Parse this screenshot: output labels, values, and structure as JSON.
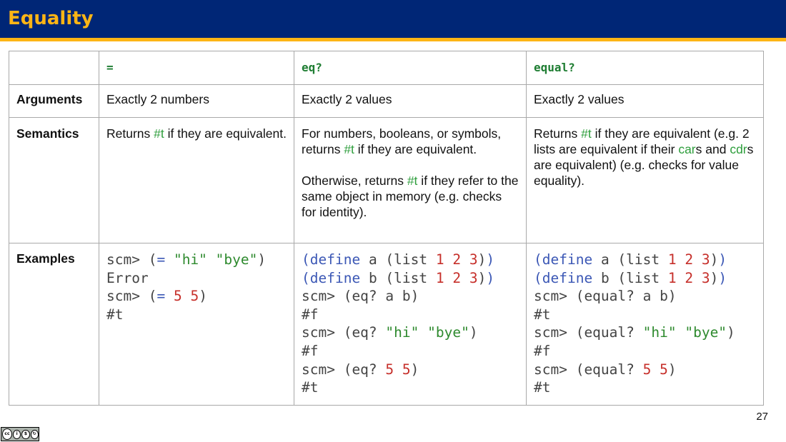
{
  "title": "Equality",
  "page_number": "27",
  "license_badge": {
    "icons": [
      "cc-icon",
      "by-icon",
      "nc-icon",
      "sa-icon"
    ],
    "glyphs": [
      "cc",
      "i",
      "$",
      "↻"
    ],
    "labels": [
      "BY",
      "NC",
      "SA"
    ]
  },
  "colors": {
    "header_bg": "#002676",
    "accent": "#FDB515",
    "code_keyword": "#3b57b5",
    "code_string": "#2e8a2e",
    "code_number": "#c62f2a",
    "highlight_green": "#2e9e3c"
  },
  "table": {
    "headers": [
      "",
      "=",
      "eq?",
      "equal?"
    ],
    "arguments": {
      "label": "Arguments",
      "values": [
        "Exactly 2 numbers",
        "Exactly 2 values",
        "Exactly 2 values"
      ]
    },
    "semantics": {
      "label": "Semantics",
      "col1": {
        "a": "Returns ",
        "t": "#t",
        "b": " if they are equivalent."
      },
      "col2": {
        "p1a": "For numbers, booleans, or symbols, returns ",
        "p1t": "#t",
        "p1b": " if they are equivalent.",
        "p2a": "Otherwise, returns ",
        "p2t": "#t",
        "p2b": " if they refer to the same object in memory (e.g. checks for identity)."
      },
      "col3": {
        "a": "Returns ",
        "t": "#t",
        "b": " if they are equivalent (e.g. 2 lists are equivalent if their ",
        "car": "car",
        "c": "s and ",
        "cdr": "cdr",
        "d": "s are equivalent) (e.g. checks for value equality)."
      }
    },
    "examples": {
      "label": "Examples",
      "col1": [
        [
          [
            "t-plain",
            "scm> ("
          ],
          [
            "t-op",
            "="
          ],
          [
            "t-plain",
            " "
          ],
          [
            "t-str",
            "\"hi\""
          ],
          [
            "t-plain",
            " "
          ],
          [
            "t-str",
            "\"bye\""
          ],
          [
            "t-plain",
            ")"
          ]
        ],
        [
          [
            "t-plain",
            "Error"
          ]
        ],
        [
          [
            "t-plain",
            "scm> ("
          ],
          [
            "t-op",
            "="
          ],
          [
            "t-plain",
            " "
          ],
          [
            "t-num",
            "5"
          ],
          [
            "t-plain",
            " "
          ],
          [
            "t-num",
            "5"
          ],
          [
            "t-plain",
            ")"
          ]
        ],
        [
          [
            "t-plain",
            "#t"
          ]
        ]
      ],
      "col2": [
        [
          [
            "t-kw",
            "("
          ],
          [
            "t-kw",
            "define"
          ],
          [
            "t-plain",
            " a (list "
          ],
          [
            "t-num",
            "1"
          ],
          [
            "t-plain",
            " "
          ],
          [
            "t-num",
            "2"
          ],
          [
            "t-plain",
            " "
          ],
          [
            "t-num",
            "3"
          ],
          [
            "t-plain",
            ")"
          ],
          [
            "t-kw",
            ")"
          ]
        ],
        [
          [
            "t-kw",
            "("
          ],
          [
            "t-kw",
            "define"
          ],
          [
            "t-plain",
            " b (list "
          ],
          [
            "t-num",
            "1"
          ],
          [
            "t-plain",
            " "
          ],
          [
            "t-num",
            "2"
          ],
          [
            "t-plain",
            " "
          ],
          [
            "t-num",
            "3"
          ],
          [
            "t-plain",
            ")"
          ],
          [
            "t-kw",
            ")"
          ]
        ],
        [
          [
            "t-plain",
            "scm> (eq? a b)"
          ]
        ],
        [
          [
            "t-plain",
            "#f"
          ]
        ],
        [
          [
            "t-plain",
            "scm> (eq? "
          ],
          [
            "t-str",
            "\"hi\""
          ],
          [
            "t-plain",
            " "
          ],
          [
            "t-str",
            "\"bye\""
          ],
          [
            "t-plain",
            ")"
          ]
        ],
        [
          [
            "t-plain",
            "#f"
          ]
        ],
        [
          [
            "t-plain",
            "scm> (eq? "
          ],
          [
            "t-num",
            "5"
          ],
          [
            "t-plain",
            " "
          ],
          [
            "t-num",
            "5"
          ],
          [
            "t-plain",
            ")"
          ]
        ],
        [
          [
            "t-plain",
            "#t"
          ]
        ]
      ],
      "col3": [
        [
          [
            "t-kw",
            "("
          ],
          [
            "t-kw",
            "define"
          ],
          [
            "t-plain",
            " a (list "
          ],
          [
            "t-num",
            "1"
          ],
          [
            "t-plain",
            " "
          ],
          [
            "t-num",
            "2"
          ],
          [
            "t-plain",
            " "
          ],
          [
            "t-num",
            "3"
          ],
          [
            "t-plain",
            ")"
          ],
          [
            "t-kw",
            ")"
          ]
        ],
        [
          [
            "t-kw",
            "("
          ],
          [
            "t-kw",
            "define"
          ],
          [
            "t-plain",
            " b (list "
          ],
          [
            "t-num",
            "1"
          ],
          [
            "t-plain",
            " "
          ],
          [
            "t-num",
            "2"
          ],
          [
            "t-plain",
            " "
          ],
          [
            "t-num",
            "3"
          ],
          [
            "t-plain",
            ")"
          ],
          [
            "t-kw",
            ")"
          ]
        ],
        [
          [
            "t-plain",
            "scm> (equal? a b)"
          ]
        ],
        [
          [
            "t-plain",
            "#t"
          ]
        ],
        [
          [
            "t-plain",
            "scm> (equal? "
          ],
          [
            "t-str",
            "\"hi\""
          ],
          [
            "t-plain",
            " "
          ],
          [
            "t-str",
            "\"bye\""
          ],
          [
            "t-plain",
            ")"
          ]
        ],
        [
          [
            "t-plain",
            "#f"
          ]
        ],
        [
          [
            "t-plain",
            "scm> (equal? "
          ],
          [
            "t-num",
            "5"
          ],
          [
            "t-plain",
            " "
          ],
          [
            "t-num",
            "5"
          ],
          [
            "t-plain",
            ")"
          ]
        ],
        [
          [
            "t-plain",
            "#t"
          ]
        ]
      ]
    }
  }
}
